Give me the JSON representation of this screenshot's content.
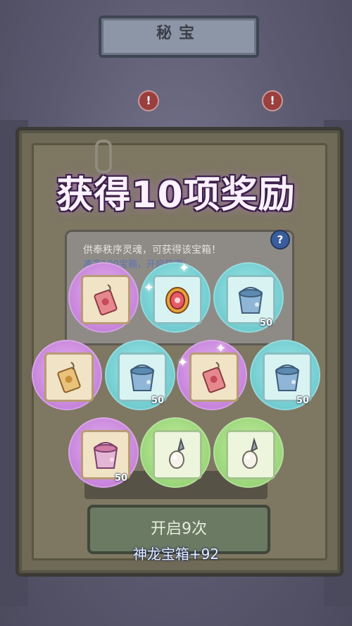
{
  "screen_title": "秘宝",
  "popup": {
    "title": "获得10项奖励",
    "info_line1": "供奉秩序灵魂，可获得该宝箱！",
    "info_line2": "凑齐100宝箱，开启获得：",
    "help_symbol": "?"
  },
  "open_button_label": "开启9次",
  "chest_label": "神龙宝箱+92",
  "alerts": [
    "!",
    "!"
  ],
  "rewards": [
    {
      "item": "pendant-red",
      "bg": "purple",
      "qty": ""
    },
    {
      "item": "mirror-amulet",
      "bg": "teal",
      "qty": ""
    },
    {
      "item": "paint-bucket-blue",
      "bg": "teal",
      "qty": "50"
    },
    {
      "item": "pendant-gold",
      "bg": "purple",
      "qty": ""
    },
    {
      "item": "paint-bucket-blue",
      "bg": "teal",
      "qty": "50"
    },
    {
      "item": "pendant-red",
      "bg": "purple",
      "qty": ""
    },
    {
      "item": "paint-bucket-blue",
      "bg": "teal",
      "qty": "50"
    },
    {
      "item": "paint-bucket-pink",
      "bg": "purple",
      "qty": "50"
    },
    {
      "item": "pearl-pendant",
      "bg": "green",
      "qty": ""
    },
    {
      "item": "pearl-pendant",
      "bg": "green",
      "qty": ""
    }
  ],
  "colors": {
    "purple": "#c886dc",
    "teal": "#73cdd1",
    "green": "#9cd77b",
    "title_glow": "#b57ad0"
  }
}
